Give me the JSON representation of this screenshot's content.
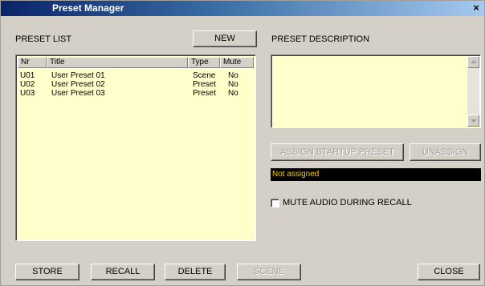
{
  "window": {
    "title": "Preset Manager",
    "close_glyph": "×"
  },
  "preset_list": {
    "label": "PRESET LIST",
    "new_label": "NEW",
    "columns": [
      "Nr",
      "Title",
      "Type",
      "Mute"
    ],
    "rows": [
      {
        "nr": "U01",
        "title": "User Preset 01",
        "type": "Scene",
        "mute": "No"
      },
      {
        "nr": "U02",
        "title": "User Preset 02",
        "type": "Preset",
        "mute": "No"
      },
      {
        "nr": "U03",
        "title": "User Preset 03",
        "type": "Preset",
        "mute": "No"
      }
    ]
  },
  "description": {
    "label": "PRESET DESCRIPTION",
    "text": ""
  },
  "startup": {
    "assign_label": "ASSIGN STARTUP PRESET",
    "unassign_label": "UNASSIGN",
    "status": "Not assigned",
    "status_color": "#ffd000"
  },
  "mute_audio": {
    "label": "MUTE AUDIO DURING RECALL",
    "checked": false
  },
  "footer": {
    "store_label": "STORE",
    "recall_label": "RECALL",
    "delete_label": "DELETE",
    "scene_label": "SCENE",
    "close_label": "CLOSE"
  },
  "colors": {
    "panel": "#d4d0c8",
    "list_bg": "#ffffcc",
    "titlebar": "#0a246a"
  }
}
